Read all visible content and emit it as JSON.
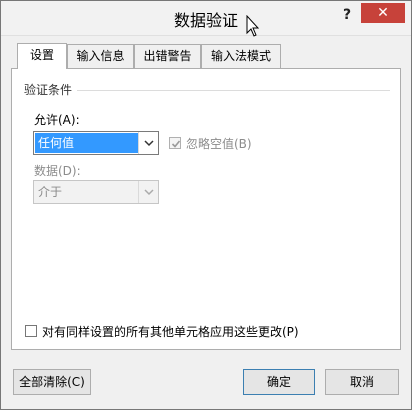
{
  "window": {
    "title": "数据验证",
    "help": "?",
    "close": "✕"
  },
  "tabs": [
    {
      "label": "设置"
    },
    {
      "label": "输入信息"
    },
    {
      "label": "出错警告"
    },
    {
      "label": "输入法模式"
    }
  ],
  "settings": {
    "group_title": "验证条件",
    "allow_label": "允许(A):",
    "allow_value": "任何值",
    "ignore_blank_label": "忽略空值(B)",
    "data_label": "数据(D):",
    "data_value": "介于",
    "apply_all_label": "对有同样设置的所有其他单元格应用这些更改(P)"
  },
  "buttons": {
    "clear_all": "全部清除(C)",
    "ok": "确定",
    "cancel": "取消"
  }
}
